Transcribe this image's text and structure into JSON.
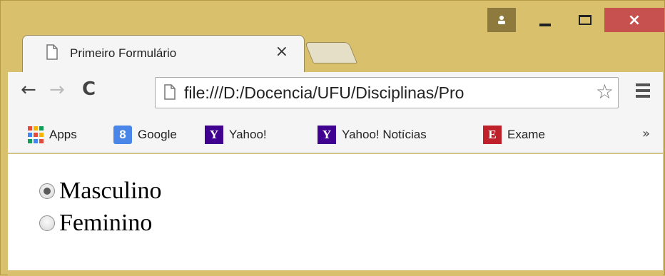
{
  "window": {
    "controls": {
      "close_glyph": "×"
    }
  },
  "tab": {
    "title": "Primeiro Formulário",
    "close_glyph": "×"
  },
  "toolbar": {
    "back_glyph": "←",
    "forward_glyph": "→",
    "reload_glyph": "C",
    "url": "file:///D:/Docencia/UFU/Disciplinas/Pro",
    "star_glyph": "☆"
  },
  "bookmarks": {
    "items": [
      {
        "label": "Apps",
        "icon": "apps-grid-icon"
      },
      {
        "label": "Google",
        "icon": "google-icon",
        "glyph": "8",
        "color": "#4a86e8"
      },
      {
        "label": "Yahoo!",
        "icon": "yahoo-icon",
        "glyph": "Y",
        "color": "#400090"
      },
      {
        "label": "Yahoo! Notícias",
        "icon": "yahoo-icon",
        "glyph": "Y",
        "color": "#400090"
      },
      {
        "label": "Exame",
        "icon": "exame-icon",
        "glyph": "E",
        "color": "#c0202a"
      }
    ],
    "more_glyph": "»"
  },
  "form": {
    "options": [
      {
        "label": "Masculino",
        "checked": true
      },
      {
        "label": "Feminino",
        "checked": false
      }
    ]
  }
}
